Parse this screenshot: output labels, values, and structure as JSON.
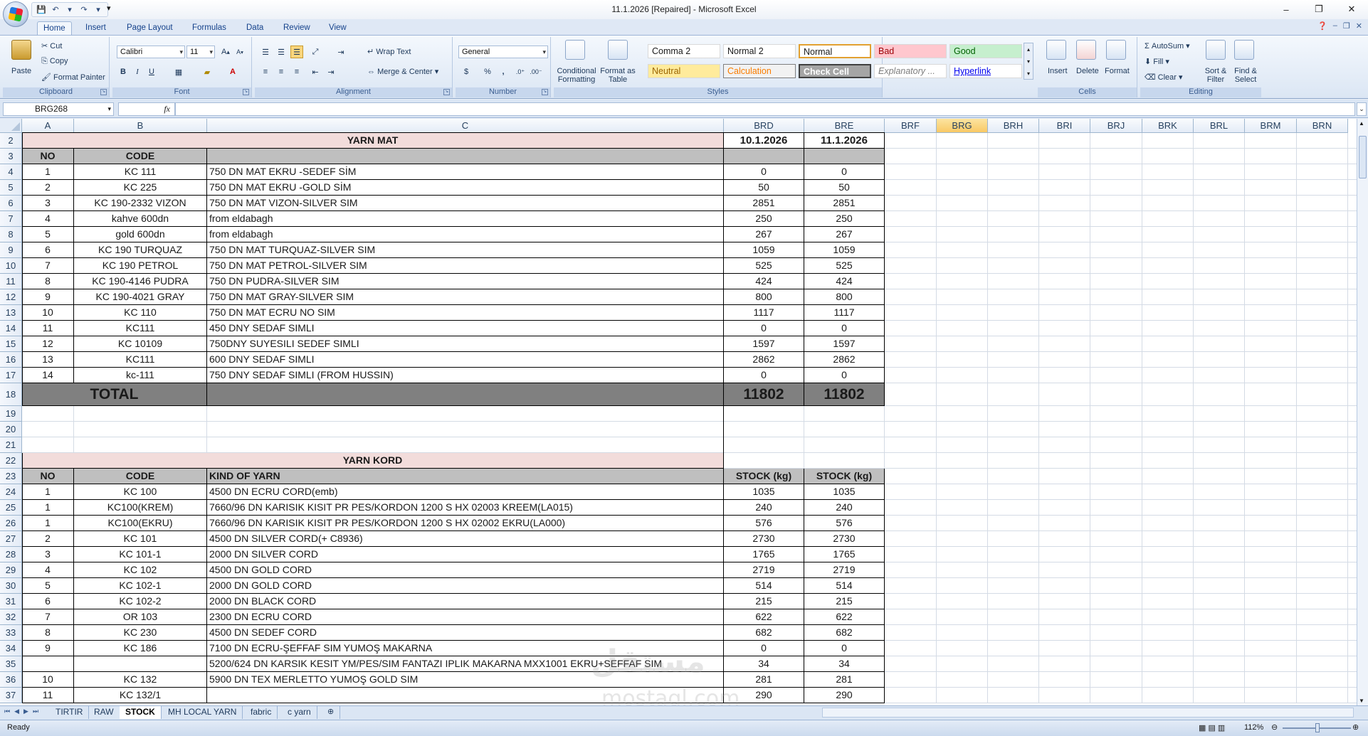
{
  "window": {
    "title": "11.1.2026 [Repaired] - Microsoft Excel",
    "minimize": "–",
    "restore": "❐",
    "close": "✕"
  },
  "ribbon_tabs": [
    "Home",
    "Insert",
    "Page Layout",
    "Formulas",
    "Data",
    "Review",
    "View"
  ],
  "clipboard": {
    "paste": "Paste",
    "cut": "Cut",
    "copy": "Copy",
    "format_painter": "Format Painter",
    "label": "Clipboard"
  },
  "font": {
    "name": "Calibri",
    "size": "11",
    "bold": "B",
    "italic": "I",
    "underline": "U",
    "label": "Font"
  },
  "alignment": {
    "wrap": "Wrap Text",
    "merge": "Merge & Center",
    "label": "Alignment"
  },
  "number": {
    "format": "General",
    "currency": "$",
    "percent": "%",
    "comma": ",",
    "label": "Number"
  },
  "styles": {
    "conditional": "Conditional Formatting",
    "format_table": "Format as Table",
    "items": [
      "Comma 2",
      "Normal 2",
      "Normal",
      "Bad",
      "Good",
      "Neutral",
      "Calculation",
      "Check Cell",
      "Explanatory ...",
      "Hyperlink"
    ],
    "label": "Styles"
  },
  "cells": {
    "insert": "Insert",
    "delete": "Delete",
    "format": "Format",
    "label": "Cells"
  },
  "editing": {
    "autosum": "AutoSum",
    "fill": "Fill",
    "clear": "Clear",
    "sort": "Sort & Filter",
    "find": "Find & Select",
    "label": "Editing"
  },
  "name_box": "BRG268",
  "fx": "fx",
  "columns": [
    "A",
    "B",
    "C",
    "BRD",
    "BRE",
    "BRF",
    "BRG",
    "BRH",
    "BRI",
    "BRJ",
    "BRK",
    "BRL",
    "BRM",
    "BRN"
  ],
  "selected_column": "BRG",
  "rows": [
    "2",
    "3",
    "4",
    "5",
    "6",
    "7",
    "8",
    "9",
    "10",
    "11",
    "12",
    "13",
    "14",
    "15",
    "16",
    "17",
    "18",
    "19",
    "20",
    "21",
    "22",
    "23",
    "24",
    "25",
    "26",
    "27",
    "28",
    "29",
    "30",
    "31",
    "32",
    "33",
    "34",
    "35",
    "36",
    "37"
  ],
  "yarn_mat": {
    "title": "YARN MAT",
    "date1": "10.1.2026",
    "date2": "11.1.2026",
    "headers": [
      "NO",
      "CODE"
    ],
    "rows": [
      [
        "1",
        "KC 111",
        "750 DN MAT EKRU -SEDEF SİM",
        "0",
        "0"
      ],
      [
        "2",
        "KC 225",
        "750 DN MAT EKRU -GOLD SİM",
        "50",
        "50"
      ],
      [
        "3",
        "KC 190-2332 VIZON",
        "750 DN MAT VIZON-SILVER SIM",
        "2851",
        "2851"
      ],
      [
        "4",
        "kahve 600dn",
        "from eldabagh",
        "250",
        "250"
      ],
      [
        "5",
        "gold 600dn",
        "from eldabagh",
        "267",
        "267"
      ],
      [
        "6",
        "KC 190 TURQUAZ",
        "750 DN MAT TURQUAZ-SILVER SIM",
        "1059",
        "1059"
      ],
      [
        "7",
        "KC 190 PETROL",
        "750 DN MAT PETROL-SILVER SIM",
        "525",
        "525"
      ],
      [
        "8",
        "KC 190-4146 PUDRA",
        " 750 DN PUDRA-SILVER SIM",
        "424",
        "424"
      ],
      [
        "9",
        "KC 190-4021 GRAY",
        "750 DN MAT GRAY-SILVER SIM",
        "800",
        "800"
      ],
      [
        "10",
        "KC 110",
        "750 DN MAT ECRU NO SIM",
        "1117",
        "1117"
      ],
      [
        "11",
        "KC111",
        "450 DNY SEDAF SIMLI",
        "0",
        "0"
      ],
      [
        "12",
        "KC 10109",
        "750DNY SUYESILI SEDEF SIMLI",
        "1597",
        "1597"
      ],
      [
        "13",
        "KC111",
        "600 DNY SEDAF SIMLI",
        "2862",
        "2862"
      ],
      [
        "14",
        "kc-111",
        "750 DNY SEDAF SIMLI (FROM HUSSIN)",
        "0",
        "0"
      ]
    ],
    "total_label": "TOTAL",
    "total1": "11802",
    "total2": "11802"
  },
  "yarn_kord": {
    "title": "YARN KORD",
    "headers": [
      "NO",
      "CODE",
      "KIND OF YARN",
      "STOCK (kg)",
      "STOCK (kg)"
    ],
    "rows": [
      [
        "1",
        "KC 100",
        "4500 DN ECRU CORD(emb)",
        "1035",
        "1035"
      ],
      [
        "1",
        "KC100(KREM)",
        "7660/96 DN KARISIK KISIT PR PES/KORDON 1200 S HX 02003 KREEM(LA015)",
        "240",
        "240"
      ],
      [
        "1",
        "KC100(EKRU)",
        "7660/96 DN KARISIK KISIT PR PES/KORDON 1200 S HX 02002 EKRU(LA000)",
        "576",
        "576"
      ],
      [
        "2",
        "KC 101",
        "4500 DN SILVER CORD(+ C8936)",
        "2730",
        "2730"
      ],
      [
        "3",
        "KC 101-1",
        "2000 DN SILVER CORD",
        "1765",
        "1765"
      ],
      [
        "4",
        "KC 102",
        "4500 DN GOLD CORD",
        "2719",
        "2719"
      ],
      [
        "5",
        "KC 102-1",
        "2000 DN GOLD CORD",
        "514",
        "514"
      ],
      [
        "6",
        "KC 102-2",
        "2000 DN BLACK CORD",
        "215",
        "215"
      ],
      [
        "7",
        "OR 103",
        "2300 DN ECRU CORD",
        "622",
        "622"
      ],
      [
        "8",
        "KC 230",
        "4500 DN SEDEF CORD",
        "682",
        "682"
      ],
      [
        "9",
        "KC 186",
        "7100 DN ECRU-ŞEFFAF SIM YUMOŞ MAKARNA",
        "0",
        "0"
      ],
      [
        "",
        "",
        "5200/624 DN KARSIK KESIT YM/PES/SIM FANTAZI IPLIK MAKARNA MXX1001  EKRU+SEFFAF SIM",
        "34",
        "34"
      ],
      [
        "10",
        "KC 132",
        "5900 DN TEX MERLETTO YUMOŞ GOLD SIM",
        "281",
        "281"
      ],
      [
        "11",
        "KC 132/1",
        "",
        "290",
        "290"
      ]
    ]
  },
  "sheet_tabs": [
    "TIRTIR",
    "RAW",
    "STOCK",
    "MH LOCAL YARN",
    "fabric",
    "c yarn"
  ],
  "active_sheet": "STOCK",
  "status": {
    "ready": "Ready",
    "zoom": "112%"
  },
  "watermark": {
    "text": "مستقل",
    "sub": "mostaql.com"
  },
  "colors": {
    "header_pink": "#f2dcdb",
    "header_gray": "#bfbfbf",
    "total_gray": "#808080",
    "selected": "#f9c965"
  }
}
